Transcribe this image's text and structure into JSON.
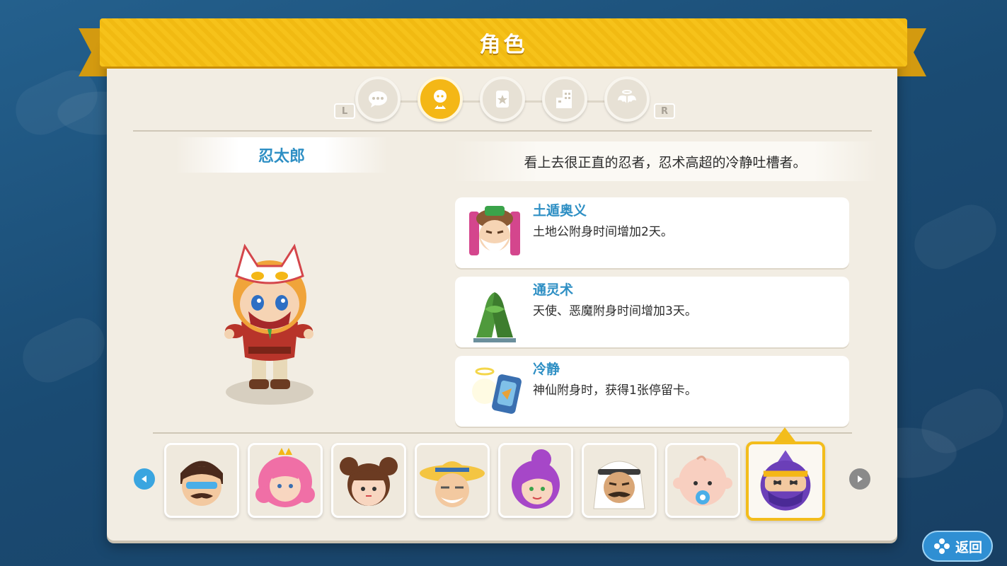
{
  "screen": {
    "title": "角色"
  },
  "tabs": [
    {
      "icon": "speech-bubble-icon",
      "active": false
    },
    {
      "icon": "character-icon",
      "active": true
    },
    {
      "icon": "card-icon",
      "active": false
    },
    {
      "icon": "building-icon",
      "active": false
    },
    {
      "icon": "angel-wings-icon",
      "active": false
    }
  ],
  "shoulder_buttons": {
    "left": "L",
    "right": "R"
  },
  "character": {
    "name": "忍太郎",
    "description": "看上去很正直的忍者，忍术高超的冷静吐槽者。"
  },
  "skills": [
    {
      "name": "土遁奥义",
      "text": "土地公附身时间增加2天。",
      "icon": "earth-god-icon"
    },
    {
      "name": "通灵术",
      "text": "天使、恶魔附身时间增加3天。",
      "icon": "hand-seal-icon"
    },
    {
      "name": "冷静",
      "text": "神仙附身时，获得1张停留卡。",
      "icon": "stay-card-icon"
    }
  ],
  "roster": [
    {
      "name": "mustache-sunglasses-man",
      "selected": false
    },
    {
      "name": "pink-princess",
      "selected": false
    },
    {
      "name": "bun-hair-girl",
      "selected": false
    },
    {
      "name": "straw-hat-grandpa",
      "selected": false
    },
    {
      "name": "purple-hair-lady",
      "selected": false
    },
    {
      "name": "arab-man",
      "selected": false
    },
    {
      "name": "pacifier-baby",
      "selected": false
    },
    {
      "name": "ninja",
      "selected": true
    }
  ],
  "back_button": {
    "label": "返回"
  },
  "colors": {
    "accent_yellow": "#f4b716",
    "accent_blue": "#2e8fc4",
    "panel": "#f2ede3"
  }
}
